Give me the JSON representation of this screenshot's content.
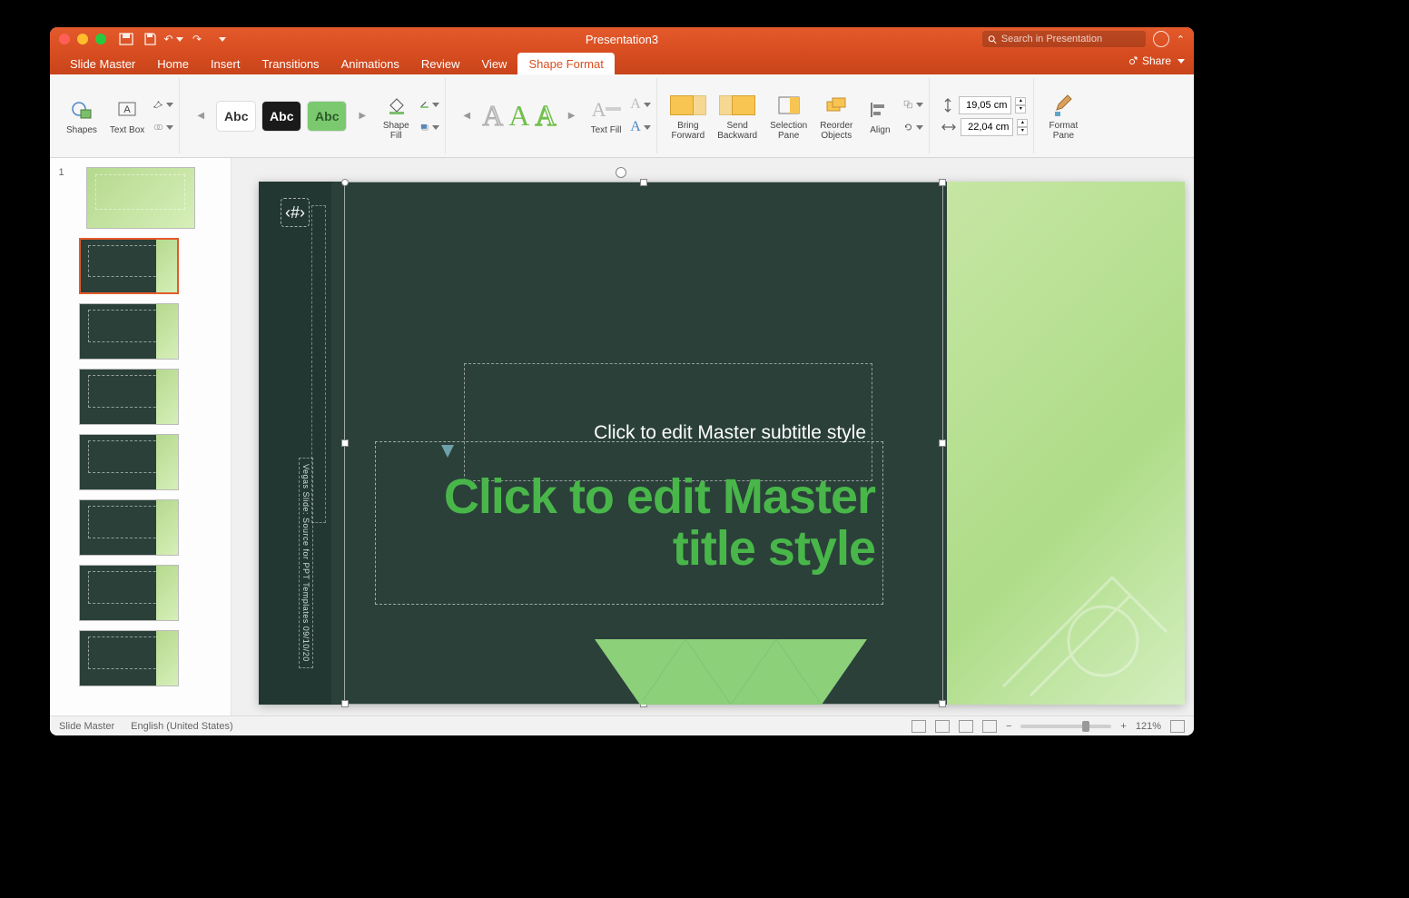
{
  "window": {
    "title": "Presentation3"
  },
  "search": {
    "placeholder": "Search in Presentation"
  },
  "tabs": {
    "slideMaster": "Slide Master",
    "home": "Home",
    "insert": "Insert",
    "transitions": "Transitions",
    "animations": "Animations",
    "review": "Review",
    "view": "View",
    "shapeFormat": "Shape Format"
  },
  "share": "Share",
  "ribbon": {
    "shapes": "Shapes",
    "textBox": "Text Box",
    "styleSample": "Abc",
    "shapeFill": "Shape\nFill",
    "textFill": "Text Fill",
    "bringForward": "Bring\nForward",
    "sendBackward": "Send\nBackward",
    "selectionPane": "Selection\nPane",
    "reorderObjects": "Reorder\nObjects",
    "align": "Align",
    "height": "19,05 cm",
    "width": "22,04 cm",
    "formatPane": "Format\nPane"
  },
  "thumbs": {
    "num1": "1"
  },
  "slide": {
    "subtitle": "Click to edit Master subtitle style",
    "title": "Click to edit Master title style",
    "footer": "Vegas Slide: Source for PPT Templates   09/10/20"
  },
  "status": {
    "view": "Slide Master",
    "lang": "English (United States)",
    "zoom": "121%"
  }
}
